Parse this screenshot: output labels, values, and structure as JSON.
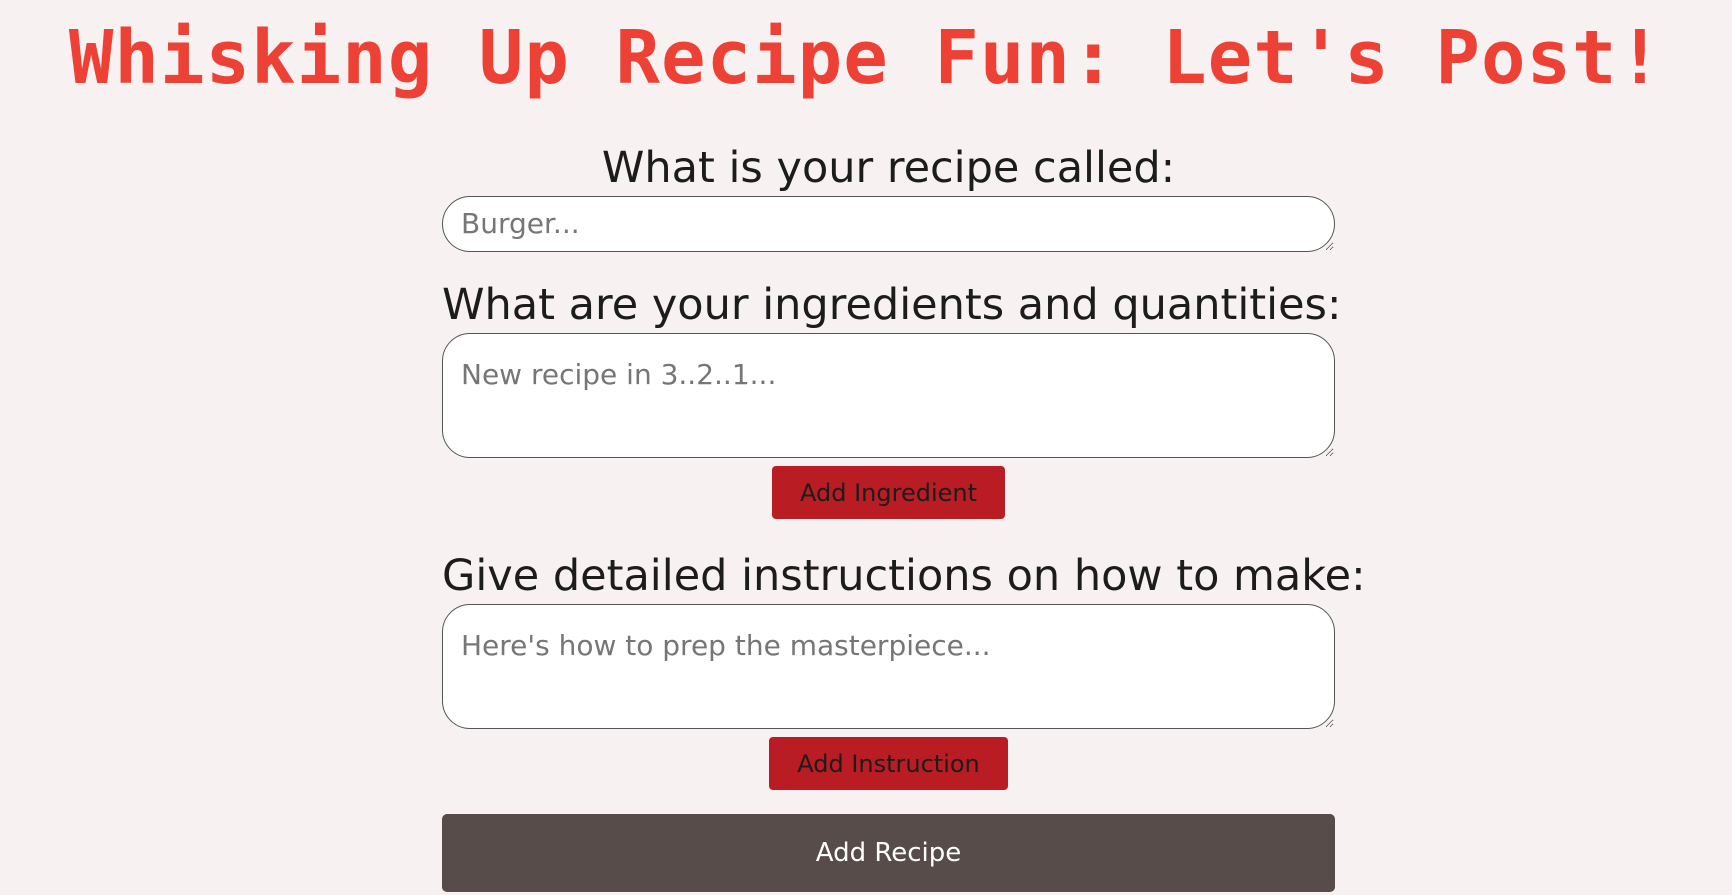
{
  "page": {
    "title": "Whisking Up Recipe Fun: Let's Post!"
  },
  "form": {
    "name": {
      "label": "What is your recipe called:",
      "placeholder": "Burger..."
    },
    "ingredients": {
      "label": "What are your ingredients and quantities:",
      "placeholder": "New recipe in 3..2..1...",
      "add_button": "Add Ingredient"
    },
    "instructions": {
      "label": "Give detailed instructions on how to make:",
      "placeholder": "Here's how to prep the masterpiece...",
      "add_button": "Add Instruction"
    },
    "submit_button": "Add Recipe"
  },
  "colors": {
    "background": "#f7f2f1",
    "title": "#ee4136",
    "small_button": "#b91c22",
    "submit_button": "#574c49"
  }
}
